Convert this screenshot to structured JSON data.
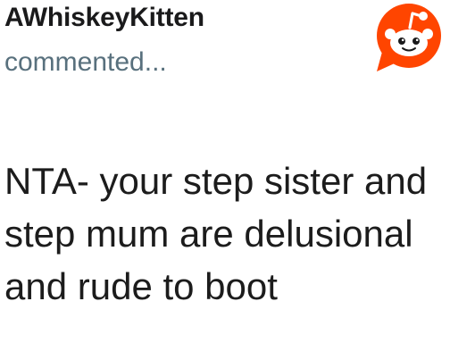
{
  "comment": {
    "username": "AWhiskeyKitten",
    "action": "commented...",
    "body": "NTA- your step sister and step mum are delusional and rude to boot"
  },
  "icons": {
    "logo": "reddit-snoo-icon"
  },
  "colors": {
    "brand": "#ff4500",
    "username": "#1a1a1b",
    "meta": "#58707d",
    "body": "#1c1c1c",
    "background": "#ffffff"
  }
}
